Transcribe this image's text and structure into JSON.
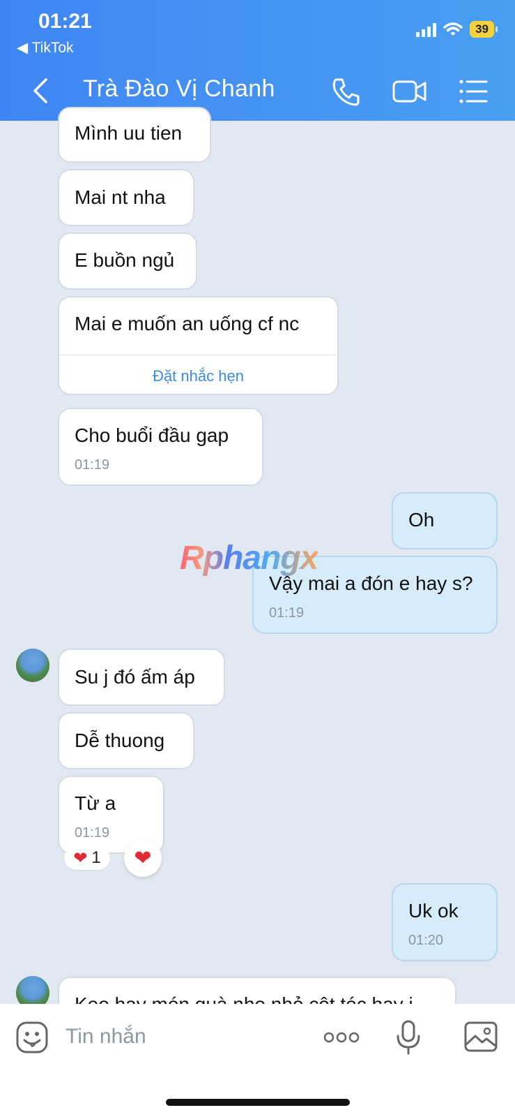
{
  "status_bar": {
    "time": "01:21",
    "back_app": "◀ TikTok",
    "battery": "39"
  },
  "header": {
    "title": "Trà Đào Vị Chanh",
    "back_icon": "chevron-left-icon",
    "call_icon": "phone-icon",
    "video_icon": "video-camera-icon",
    "menu_icon": "list-icon"
  },
  "messages": [
    {
      "side": "in",
      "text": "Mình uu tien"
    },
    {
      "side": "in",
      "text": "Mai nt nha"
    },
    {
      "side": "in",
      "text": "E buồn ngủ"
    },
    {
      "side": "in",
      "text": "Mai e muốn an uống cf nc",
      "action": "Đặt nhắc hẹn"
    },
    {
      "side": "in",
      "text": "Cho buổi đầu gap",
      "time": "01:19"
    },
    {
      "side": "out",
      "text": "Oh"
    },
    {
      "side": "out",
      "text": "Vậy mai a đón e hay s?",
      "time": "01:19"
    },
    {
      "side": "in",
      "text": "Su j đó ấm áp"
    },
    {
      "side": "in",
      "text": "Dễ thuong"
    },
    {
      "side": "in",
      "text": "Từ a",
      "time": "01:19",
      "reaction_count": "1"
    },
    {
      "side": "out",
      "text": "Uk ok",
      "time": "01:20"
    },
    {
      "side": "in",
      "text": "Keo hay món quà nho nhỏ cột tóc hay j"
    }
  ],
  "watermark": "Rphangx",
  "input": {
    "placeholder": "Tin nhắn",
    "sticker_icon": "sticker-icon",
    "more_icon": "more-dots-icon",
    "mic_icon": "microphone-icon",
    "image_icon": "image-icon"
  }
}
